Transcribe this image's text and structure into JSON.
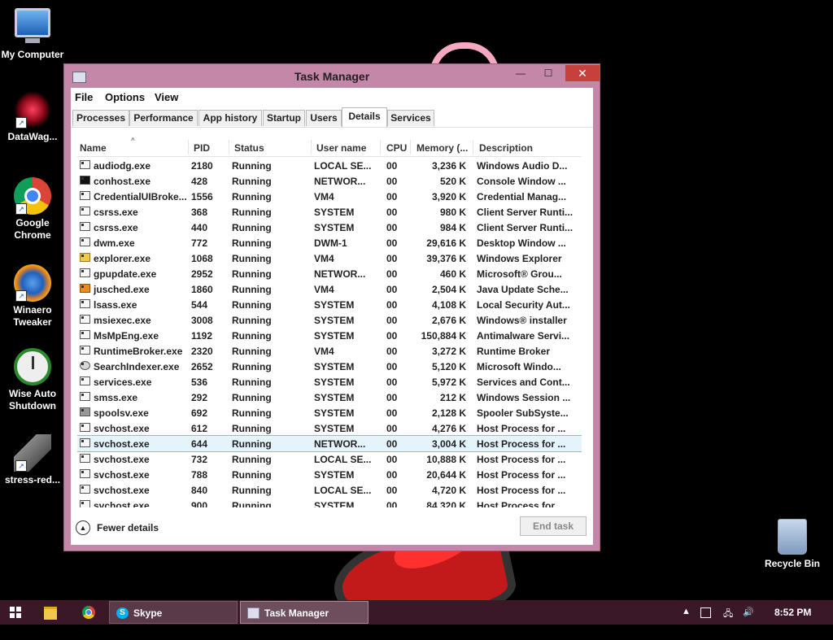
{
  "desktop": {
    "icons": [
      {
        "label": "My Computer"
      },
      {
        "label": "DataWag..."
      },
      {
        "label": "Google Chrome"
      },
      {
        "label": "Winaero Tweaker"
      },
      {
        "label": "Wise Auto Shutdown"
      },
      {
        "label": "stress-red..."
      },
      {
        "label": "Recycle Bin"
      }
    ]
  },
  "window": {
    "title": "Task Manager",
    "controls": {
      "minimize": "—",
      "maximize": "☐",
      "close": "✕"
    },
    "menu": [
      "File",
      "Options",
      "View"
    ],
    "tabs": [
      "Processes",
      "Performance",
      "App history",
      "Startup",
      "Users",
      "Details",
      "Services"
    ],
    "active_tab": "Details",
    "columns": [
      "Name",
      "PID",
      "Status",
      "User name",
      "CPU",
      "Memory (...",
      "Description"
    ],
    "rows": [
      {
        "name": "audiodg.exe",
        "pid": "2180",
        "status": "Running",
        "user": "LOCAL SE...",
        "cpu": "00",
        "mem": "3,236 K",
        "desc": "Windows Audio D..."
      },
      {
        "name": "conhost.exe",
        "pid": "428",
        "status": "Running",
        "user": "NETWOR...",
        "cpu": "00",
        "mem": "520 K",
        "desc": "Console Window ..."
      },
      {
        "name": "CredentialUIBroke...",
        "pid": "1556",
        "status": "Running",
        "user": "VM4",
        "cpu": "00",
        "mem": "3,920 K",
        "desc": "Credential Manag..."
      },
      {
        "name": "csrss.exe",
        "pid": "368",
        "status": "Running",
        "user": "SYSTEM",
        "cpu": "00",
        "mem": "980 K",
        "desc": "Client Server Runti..."
      },
      {
        "name": "csrss.exe",
        "pid": "440",
        "status": "Running",
        "user": "SYSTEM",
        "cpu": "00",
        "mem": "984 K",
        "desc": "Client Server Runti..."
      },
      {
        "name": "dwm.exe",
        "pid": "772",
        "status": "Running",
        "user": "DWM-1",
        "cpu": "00",
        "mem": "29,616 K",
        "desc": "Desktop Window ..."
      },
      {
        "name": "explorer.exe",
        "pid": "1068",
        "status": "Running",
        "user": "VM4",
        "cpu": "00",
        "mem": "39,376 K",
        "desc": "Windows Explorer"
      },
      {
        "name": "gpupdate.exe",
        "pid": "2952",
        "status": "Running",
        "user": "NETWOR...",
        "cpu": "00",
        "mem": "460 K",
        "desc": "Microsoft® Grou..."
      },
      {
        "name": "jusched.exe",
        "pid": "1860",
        "status": "Running",
        "user": "VM4",
        "cpu": "00",
        "mem": "2,504 K",
        "desc": "Java Update Sche..."
      },
      {
        "name": "lsass.exe",
        "pid": "544",
        "status": "Running",
        "user": "SYSTEM",
        "cpu": "00",
        "mem": "4,108 K",
        "desc": "Local Security Aut..."
      },
      {
        "name": "msiexec.exe",
        "pid": "3008",
        "status": "Running",
        "user": "SYSTEM",
        "cpu": "00",
        "mem": "2,676 K",
        "desc": "Windows® installer"
      },
      {
        "name": "MsMpEng.exe",
        "pid": "1192",
        "status": "Running",
        "user": "SYSTEM",
        "cpu": "00",
        "mem": "150,884 K",
        "desc": "Antimalware Servi..."
      },
      {
        "name": "RuntimeBroker.exe",
        "pid": "2320",
        "status": "Running",
        "user": "VM4",
        "cpu": "00",
        "mem": "3,272 K",
        "desc": "Runtime Broker"
      },
      {
        "name": "SearchIndexer.exe",
        "pid": "2652",
        "status": "Running",
        "user": "SYSTEM",
        "cpu": "00",
        "mem": "5,120 K",
        "desc": "Microsoft Windo..."
      },
      {
        "name": "services.exe",
        "pid": "536",
        "status": "Running",
        "user": "SYSTEM",
        "cpu": "00",
        "mem": "5,972 K",
        "desc": "Services and Cont..."
      },
      {
        "name": "smss.exe",
        "pid": "292",
        "status": "Running",
        "user": "SYSTEM",
        "cpu": "00",
        "mem": "212 K",
        "desc": "Windows Session ..."
      },
      {
        "name": "spoolsv.exe",
        "pid": "692",
        "status": "Running",
        "user": "SYSTEM",
        "cpu": "00",
        "mem": "2,128 K",
        "desc": "Spooler SubSyste..."
      },
      {
        "name": "svchost.exe",
        "pid": "612",
        "status": "Running",
        "user": "SYSTEM",
        "cpu": "00",
        "mem": "4,276 K",
        "desc": "Host Process for ..."
      },
      {
        "name": "svchost.exe",
        "pid": "644",
        "status": "Running",
        "user": "NETWOR...",
        "cpu": "00",
        "mem": "3,004 K",
        "desc": "Host Process for ..."
      },
      {
        "name": "svchost.exe",
        "pid": "732",
        "status": "Running",
        "user": "LOCAL SE...",
        "cpu": "00",
        "mem": "10,888 K",
        "desc": "Host Process for ..."
      },
      {
        "name": "svchost.exe",
        "pid": "788",
        "status": "Running",
        "user": "SYSTEM",
        "cpu": "00",
        "mem": "20,644 K",
        "desc": "Host Process for ..."
      },
      {
        "name": "svchost.exe",
        "pid": "840",
        "status": "Running",
        "user": "LOCAL SE...",
        "cpu": "00",
        "mem": "4,720 K",
        "desc": "Host Process for ..."
      },
      {
        "name": "svchost.exe",
        "pid": "900",
        "status": "Running",
        "user": "SYSTEM",
        "cpu": "00",
        "mem": "84,320 K",
        "desc": "Host Process for ..."
      }
    ],
    "fewer_details": "Fewer details",
    "end_task": "End task"
  },
  "taskbar": {
    "tasks": [
      {
        "label": "Skype"
      },
      {
        "label": "Task Manager"
      }
    ],
    "time": "8:52 PM"
  }
}
